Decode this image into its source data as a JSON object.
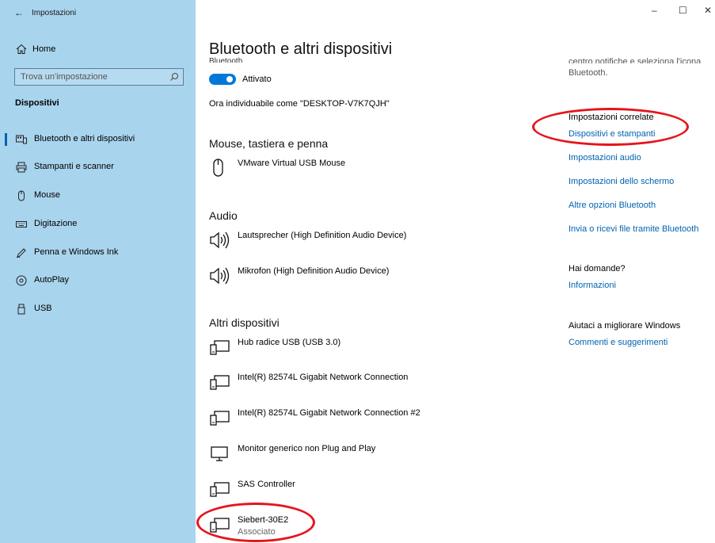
{
  "window": {
    "title": "Impostazioni",
    "back_glyph": "←",
    "minimize_glyph": "–",
    "maximize_glyph": "☐",
    "close_glyph": "✕"
  },
  "sidebar": {
    "home_label": "Home",
    "search_placeholder": "Trova un'impostazione",
    "section_title": "Dispositivi",
    "items": [
      {
        "label": "Bluetooth e altri dispositivi",
        "icon": "bluetooth-devices-icon",
        "selected": true
      },
      {
        "label": "Stampanti e scanner",
        "icon": "printer-icon",
        "selected": false
      },
      {
        "label": "Mouse",
        "icon": "mouse-icon",
        "selected": false
      },
      {
        "label": "Digitazione",
        "icon": "keyboard-icon",
        "selected": false
      },
      {
        "label": "Penna e Windows Ink",
        "icon": "pen-icon",
        "selected": false
      },
      {
        "label": "AutoPlay",
        "icon": "autoplay-icon",
        "selected": false
      },
      {
        "label": "USB",
        "icon": "usb-icon",
        "selected": false
      }
    ]
  },
  "main": {
    "title": "Bluetooth e altri dispositivi",
    "bluetooth_label_cut": "Bluetooth",
    "bluetooth_toggle": {
      "state": "on",
      "label": "Attivato"
    },
    "discoverable_text": "Ora individuabile come \"DESKTOP-V7K7QJH\"",
    "groups": [
      {
        "title": "Mouse, tastiera e penna",
        "devices": [
          {
            "name": "VMware Virtual USB Mouse",
            "icon": "mouse-icon"
          }
        ]
      },
      {
        "title": "Audio",
        "devices": [
          {
            "name": "Lautsprecher (High Definition Audio Device)",
            "icon": "speaker-icon"
          },
          {
            "name": "Mikrofon (High Definition Audio Device)",
            "icon": "speaker-icon"
          }
        ]
      },
      {
        "title": "Altri dispositivi",
        "devices": [
          {
            "name": "Hub radice USB (USB 3.0)",
            "icon": "device-icon"
          },
          {
            "name": "Intel(R) 82574L Gigabit Network Connection",
            "icon": "device-icon"
          },
          {
            "name": "Intel(R) 82574L Gigabit Network Connection #2",
            "icon": "device-icon"
          },
          {
            "name": "Monitor generico non Plug and Play",
            "icon": "monitor-icon"
          },
          {
            "name": "SAS Controller",
            "icon": "device-icon"
          },
          {
            "name": "Siebert-30E2",
            "status": "Associato",
            "icon": "device-icon"
          }
        ]
      }
    ]
  },
  "right": {
    "cut_line": "centro notifiche e seleziona l'icona",
    "bluetooth_line": "Bluetooth.",
    "related_title": "Impostazioni correlate",
    "related_links": [
      "Dispositivi e stampanti",
      "Impostazioni audio",
      "Impostazioni dello schermo",
      "Altre opzioni Bluetooth",
      "Invia o ricevi file tramite Bluetooth"
    ],
    "questions_title": "Hai domande?",
    "questions_link": "Informazioni",
    "improve_title": "Aiutaci a migliorare Windows",
    "improve_link": "Commenti e suggerimenti"
  },
  "colors": {
    "sidebar_bg": "#a9d4ed",
    "accent": "#0078d7",
    "link": "#0063b1",
    "highlight": "#e5151b"
  }
}
